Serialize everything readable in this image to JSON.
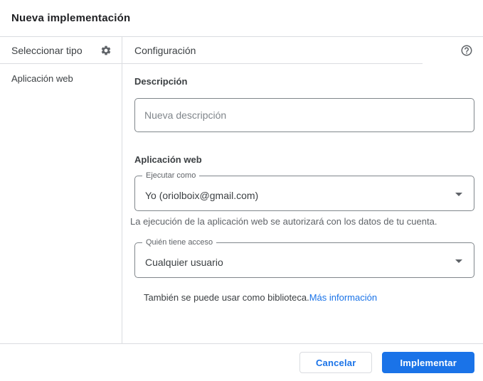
{
  "dialog": {
    "title": "Nueva implementación"
  },
  "sidebar": {
    "header": "Seleccionar tipo",
    "items": [
      {
        "label": "Aplicación web"
      }
    ]
  },
  "config": {
    "header": "Configuración",
    "description": {
      "label": "Descripción",
      "placeholder": "Nueva descripción"
    },
    "section_label": "Aplicación web",
    "execute_as": {
      "label": "Ejecutar como",
      "value": "Yo (oriolboix@gmail.com)"
    },
    "execute_helper": "La ejecución de la aplicación web se autorizará con los datos de tu cuenta.",
    "access": {
      "label": "Quién tiene acceso",
      "value": "Cualquier usuario"
    },
    "library_note": "También se puede usar como biblioteca.",
    "library_link": "Más información"
  },
  "footer": {
    "cancel_label": "Cancelar",
    "deploy_label": "Implementar"
  },
  "icons": {
    "settings": "gear-icon",
    "help": "help-circle-icon",
    "dropdown": "caret-down-icon"
  },
  "colors": {
    "accent": "#1a73e8",
    "text_primary": "#3c4043",
    "text_secondary": "#5f6368",
    "divider": "#dadce0",
    "field_border": "#80868b",
    "deploy_button_bg": "#1a73e8",
    "deploy_button_text": "#ffffff"
  }
}
